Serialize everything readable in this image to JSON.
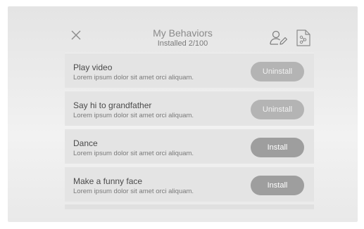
{
  "header": {
    "title": "My Behaviors",
    "subtitle": "Installed 2/100",
    "close_icon": "close-icon",
    "profile_edit_icon": "user-edit-icon",
    "document_icon": "document-icon"
  },
  "behaviors": [
    {
      "title": "Play video",
      "description": "Lorem ipsum dolor sit amet orci aliquam.",
      "action": "Uninstall"
    },
    {
      "title": "Say hi to grandfather",
      "description": "Lorem ipsum dolor sit amet orci aliquam.",
      "action": "Uninstall"
    },
    {
      "title": "Dance",
      "description": "Lorem ipsum dolor sit amet orci aliquam.",
      "action": "Install"
    },
    {
      "title": "Make a funny face",
      "description": "Lorem ipsum dolor sit amet orci aliquam.",
      "action": "Install"
    }
  ],
  "colors": {
    "uninstall_button": "#b4b4b4",
    "install_button": "#9e9e9e",
    "row_background": "#e4e4e4"
  }
}
